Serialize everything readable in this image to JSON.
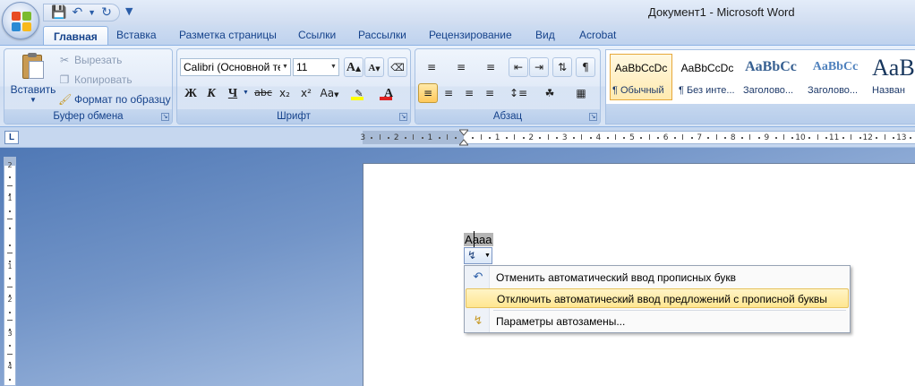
{
  "window": {
    "title": "Документ1 - Microsoft Word"
  },
  "quick_access": {
    "save_icon": "save-icon",
    "undo_icon": "undo-icon",
    "redo_icon": "repeat-icon",
    "customize_icon": "customize-qat-icon"
  },
  "tabs": [
    {
      "label": "Главная",
      "active": true
    },
    {
      "label": "Вставка"
    },
    {
      "label": "Разметка страницы"
    },
    {
      "label": "Ссылки"
    },
    {
      "label": "Рассылки"
    },
    {
      "label": "Рецензирование"
    },
    {
      "label": "Вид"
    },
    {
      "label": "Acrobat"
    }
  ],
  "clipboard": {
    "paste_label": "Вставить",
    "cut_label": "Вырезать",
    "copy_label": "Копировать",
    "format_painter_label": "Формат по образцу",
    "group_label": "Буфер обмена"
  },
  "font": {
    "font_name": "Calibri (Основной те",
    "font_size": "11",
    "group_label": "Шрифт",
    "grow_label": "A",
    "shrink_label": "A",
    "bold_label": "Ж",
    "italic_label": "К",
    "underline_label": "Ч",
    "strike_label": "abc",
    "subscript_label": "x₂",
    "superscript_label": "x²",
    "change_case_label": "Aa",
    "font_color_label": "A",
    "highlight_color": "#ffff00",
    "font_color": "#e02020"
  },
  "paragraph": {
    "group_label": "Абзац"
  },
  "styles": [
    {
      "sample": "AaBbCcDc",
      "name": "¶ Обычный",
      "selected": true
    },
    {
      "sample": "AaBbCcDc",
      "name": "¶ Без инте..."
    },
    {
      "sample": "AaBbCc",
      "name": "Заголово..."
    },
    {
      "sample": "AaBbCc",
      "name": "Заголово..."
    },
    {
      "sample": "AaB",
      "name": "Назван"
    }
  ],
  "ruler": {
    "corner_label": "L",
    "h_numbers": [
      "3",
      "2",
      "1",
      "1",
      "2",
      "3",
      "4",
      "5",
      "6",
      "7",
      "8",
      "9",
      "10",
      "11",
      "12",
      "13"
    ],
    "v_numbers": [
      "2",
      "1",
      "1",
      "2",
      "3",
      "4"
    ]
  },
  "document": {
    "word": "Аааа"
  },
  "autocorrect_menu": {
    "items": [
      {
        "icon": "undo-icon",
        "label": "Отменить автоматический ввод прописных букв"
      },
      {
        "icon": "",
        "label": "Отключить автоматический ввод предложений с прописной буквы",
        "highlighted": true
      },
      {
        "icon": "autocorrect-options-icon",
        "label": "Параметры автозамены..."
      }
    ]
  }
}
